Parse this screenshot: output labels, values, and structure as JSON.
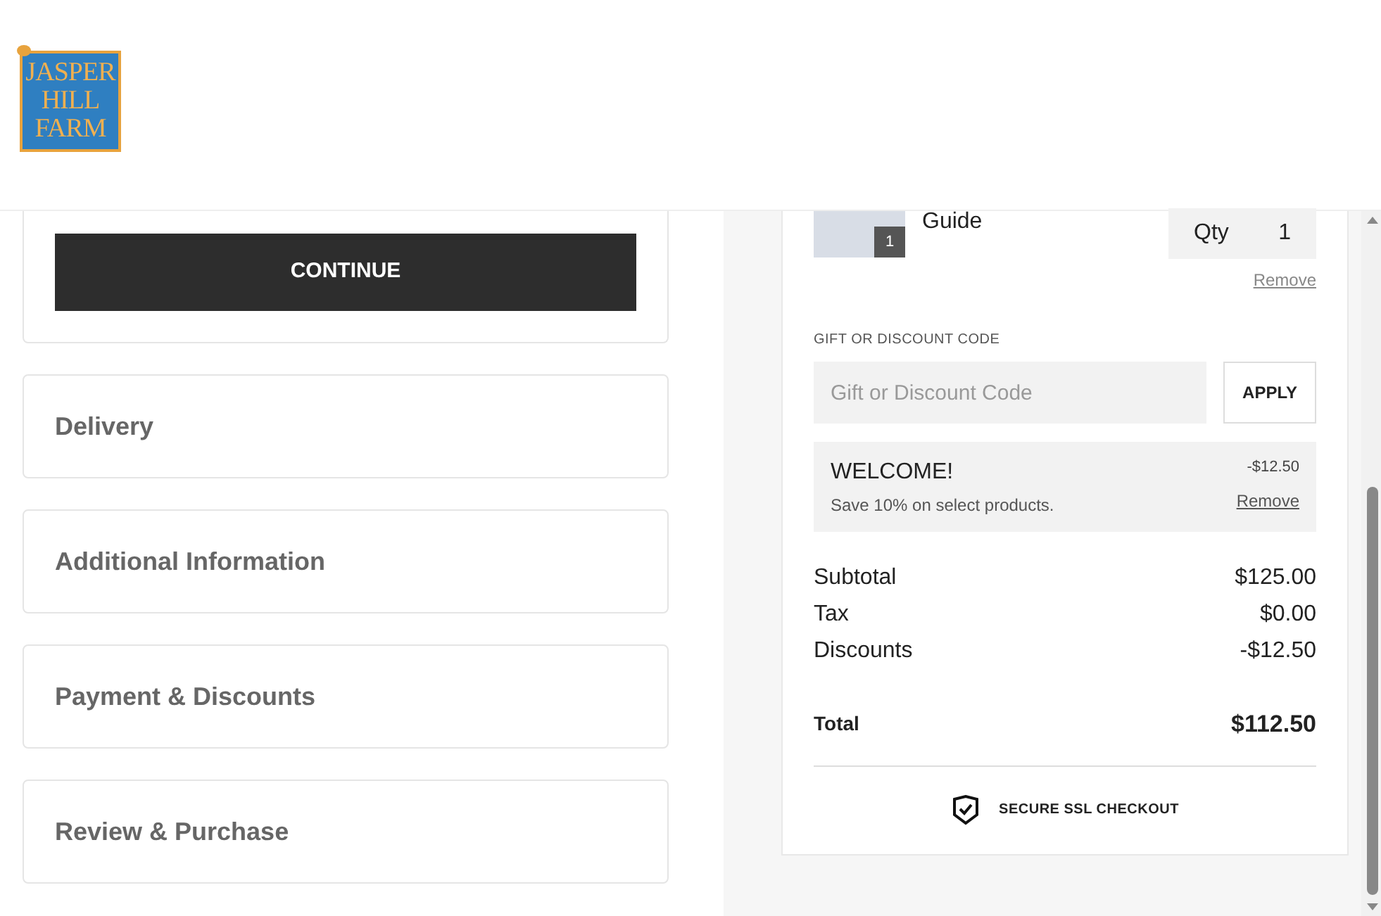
{
  "logo": {
    "lines": [
      "JASPER",
      "HILL",
      "FARM"
    ]
  },
  "continue_button": "CONTINUE",
  "sections": [
    {
      "title": "Delivery"
    },
    {
      "title": "Additional Information"
    },
    {
      "title": "Payment & Discounts"
    },
    {
      "title": "Review & Purchase"
    }
  ],
  "cart_item": {
    "name": "Guide",
    "count": "1",
    "qty_label": "Qty",
    "qty": "1",
    "remove": "Remove"
  },
  "discount": {
    "label": "GIFT OR DISCOUNT CODE",
    "placeholder": "Gift or Discount Code",
    "apply": "APPLY",
    "applied": {
      "code": "WELCOME!",
      "description": "Save 10% on select products.",
      "amount": "-$12.50",
      "remove": "Remove"
    }
  },
  "totals": [
    {
      "label": "Subtotal",
      "value": "$125.00"
    },
    {
      "label": "Tax",
      "value": "$0.00"
    },
    {
      "label": "Discounts",
      "value": "-$12.50"
    }
  ],
  "total": {
    "label": "Total",
    "value": "$112.50"
  },
  "secure": "SECURE SSL CHECKOUT"
}
